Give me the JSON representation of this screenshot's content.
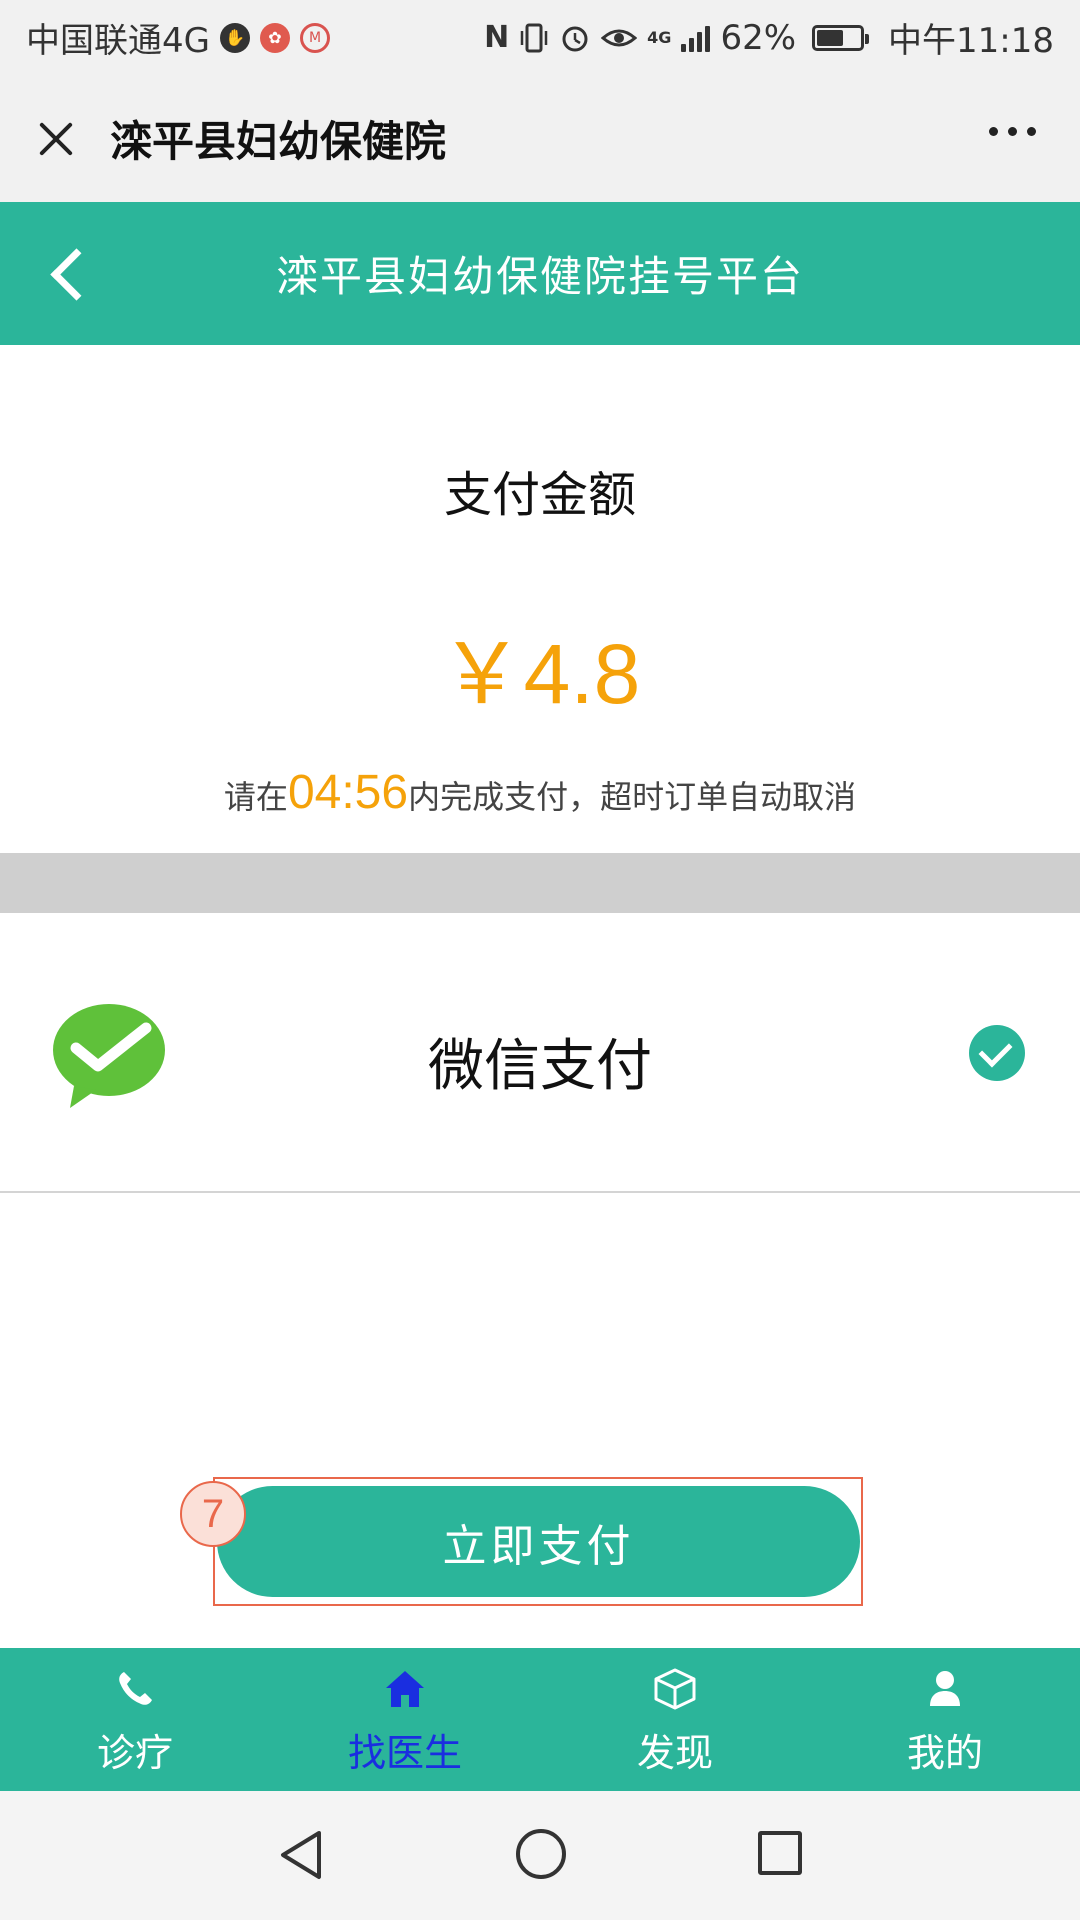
{
  "status_bar": {
    "carrier": "中国联通4G",
    "network": "4G",
    "battery_percent": "62%",
    "battery_level": 0.62,
    "time": "中午11:18"
  },
  "wechat_header": {
    "title": "滦平县妇幼保健院",
    "close_icon": "close-icon",
    "more_icon": "more-icon"
  },
  "page_header": {
    "title": "滦平县妇幼保健院挂号平台",
    "back_icon": "chevron-left-icon"
  },
  "payment": {
    "label": "支付金额",
    "amount": "￥4.8",
    "note_prefix": "请在",
    "countdown": "04:56",
    "note_suffix": "内完成支付，超时订单自动取消"
  },
  "method": {
    "label": "微信支付",
    "selected": true
  },
  "pay_button": {
    "label": "立即支付",
    "step_badge": "7"
  },
  "tabs": [
    {
      "label": "诊疗",
      "icon": "phone-icon",
      "active": false
    },
    {
      "label": "找医生",
      "icon": "home-icon",
      "active": true
    },
    {
      "label": "发现",
      "icon": "cube-icon",
      "active": false
    },
    {
      "label": "我的",
      "icon": "user-icon",
      "active": false
    }
  ],
  "colors": {
    "accent": "#2bb59a",
    "amount": "#f5a20a",
    "active_tab": "#1a2ee0",
    "annotation": "#e9684b"
  }
}
